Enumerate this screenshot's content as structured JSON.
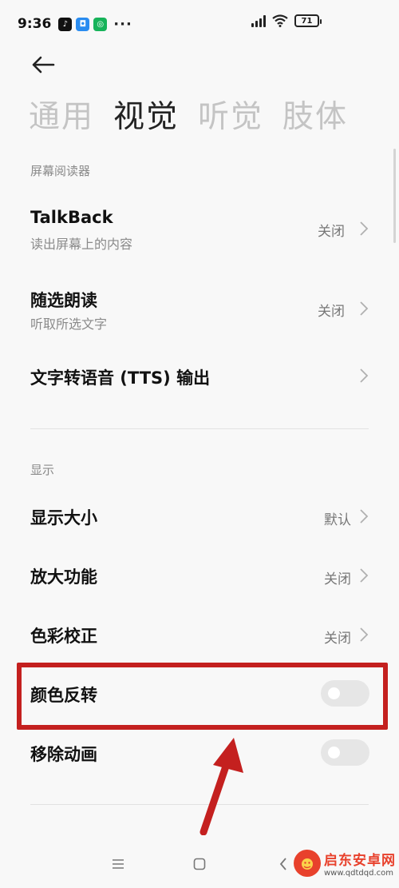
{
  "status_bar": {
    "time": "9:36",
    "apps": [
      {
        "icon": "tiktok-icon",
        "color": "#111111",
        "glyph": "♪"
      },
      {
        "icon": "message-icon",
        "color": "#2a8cf0",
        "glyph": "◘"
      },
      {
        "icon": "shield-app-icon",
        "color": "#17b35a",
        "glyph": "◎"
      }
    ],
    "more": "···",
    "battery": "71"
  },
  "tabs": [
    {
      "label": "通用",
      "active": false
    },
    {
      "label": "视觉",
      "active": true
    },
    {
      "label": "听觉",
      "active": false
    },
    {
      "label": "肢体",
      "active": false
    }
  ],
  "screen_reader": {
    "header": "屏幕阅读器",
    "talkback": {
      "title": "TalkBack",
      "subtitle": "读出屏幕上的内容",
      "value": "关闭"
    },
    "select_to_speak": {
      "title": "随选朗读",
      "subtitle": "听取所选文字",
      "value": "关闭"
    },
    "tts": {
      "title": "文字转语音 (TTS) 输出"
    }
  },
  "display": {
    "header": "显示",
    "display_size": {
      "title": "显示大小",
      "value": "默认"
    },
    "magnification": {
      "title": "放大功能",
      "value": "关闭"
    },
    "color_correction": {
      "title": "色彩校正",
      "value": "关闭"
    },
    "color_inversion": {
      "title": "颜色反转",
      "on": false
    },
    "remove_animations": {
      "title": "移除动画",
      "on": false
    }
  },
  "watermark": {
    "title": "启东安卓网",
    "url": "www.qdtdqd.com"
  },
  "colors": {
    "highlight": "#c4201f",
    "brand": "#e8412c"
  }
}
